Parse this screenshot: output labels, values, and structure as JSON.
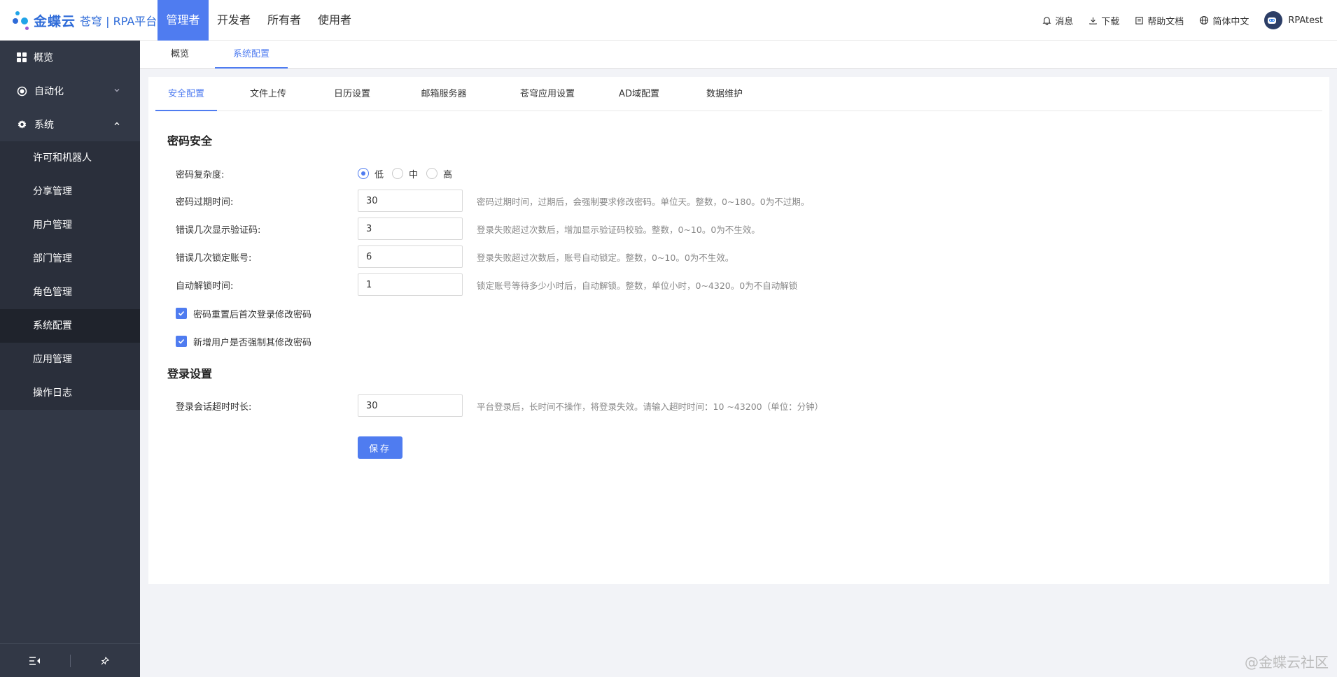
{
  "header": {
    "logo_brand": "金蝶云",
    "logo_sub": "苍穹 | RPA平台",
    "roles": [
      {
        "label": "管理者",
        "active": true
      },
      {
        "label": "开发者",
        "active": false
      },
      {
        "label": "所有者",
        "active": false
      },
      {
        "label": "使用者",
        "active": false
      }
    ],
    "messages": "消息",
    "download": "下载",
    "help_docs": "帮助文档",
    "language": "简体中文",
    "username": "RPAtest"
  },
  "sidebar": {
    "overview": "概览",
    "automation": "自动化",
    "system": "系统",
    "sub_items": [
      {
        "label": "许可和机器人",
        "active": false
      },
      {
        "label": "分享管理",
        "active": false
      },
      {
        "label": "用户管理",
        "active": false
      },
      {
        "label": "部门管理",
        "active": false
      },
      {
        "label": "角色管理",
        "active": false
      },
      {
        "label": "系统配置",
        "active": true
      },
      {
        "label": "应用管理",
        "active": false
      },
      {
        "label": "操作日志",
        "active": false
      }
    ]
  },
  "subtabs": {
    "overview": "概览",
    "system_config": "系统配置"
  },
  "tabs": [
    {
      "label": "安全配置",
      "active": true
    },
    {
      "label": "文件上传",
      "active": false
    },
    {
      "label": "日历设置",
      "active": false
    },
    {
      "label": "邮箱服务器",
      "active": false
    },
    {
      "label": "苍穹应用设置",
      "active": false
    },
    {
      "label": "AD域配置",
      "active": false
    },
    {
      "label": "数据维护",
      "active": false
    }
  ],
  "password_security": {
    "title": "密码安全",
    "complexity_label": "密码复杂度:",
    "complexity_options": [
      "低",
      "中",
      "高"
    ],
    "complexity_selected": "低",
    "expire_label": "密码过期时间:",
    "expire_value": "30",
    "expire_hint": "密码过期时间，过期后，会强制要求修改密码。单位天。整数，0~180。0为不过期。",
    "captcha_label": "错误几次显示验证码:",
    "captcha_value": "3",
    "captcha_hint": "登录失败超过次数后，增加显示验证码校验。整数，0~10。0为不生效。",
    "lock_label": "错误几次锁定账号:",
    "lock_value": "6",
    "lock_hint": "登录失败超过次数后，账号自动锁定。整数，0~10。0为不生效。",
    "unlock_label": "自动解锁时间:",
    "unlock_value": "1",
    "unlock_hint": "锁定账号等待多少小时后，自动解锁。整数，单位小时，0~4320。0为不自动解锁",
    "reset_check_label": "密码重置后首次登录修改密码",
    "reset_checked": true,
    "newuser_check_label": "新增用户是否强制其修改密码",
    "newuser_checked": true
  },
  "login_settings": {
    "title": "登录设置",
    "timeout_label": "登录会话超时时长:",
    "timeout_value": "30",
    "timeout_hint": "平台登录后，长时间不操作，将登录失效。请输入超时时间：10 ~43200（单位：分钟）"
  },
  "save_label": "保存",
  "watermark": "@金蝶云社区",
  "colors": {
    "accent": "#4f7cf0",
    "sidebar_bg": "#323846"
  }
}
